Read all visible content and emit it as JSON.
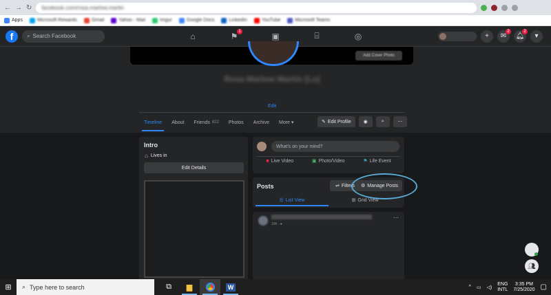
{
  "browser": {
    "url": "facebook.com/rosa.marlow.martin",
    "bookmarks": [
      "Apps",
      "Microsoft Rewards",
      "Gmail",
      "Yahoo - Mail",
      "Imgur",
      "Google Docs",
      "LinkedIn",
      "YouTube",
      "Microsoft Teams"
    ]
  },
  "header": {
    "search_placeholder": "Search Facebook",
    "nav_badge": "1",
    "messenger_badge": "2",
    "notifications_badge": "2"
  },
  "profile": {
    "add_cover_label": "Add Cover Photo",
    "name": "Rosa Marlow Martin (Lo)",
    "edit_link": "Edit",
    "tabs": [
      {
        "label": "Timeline"
      },
      {
        "label": "About"
      },
      {
        "label": "Friends",
        "count": "822"
      },
      {
        "label": "Photos"
      },
      {
        "label": "Archive"
      },
      {
        "label": "More"
      }
    ],
    "edit_profile_label": "Edit Profile"
  },
  "intro": {
    "title": "Intro",
    "lives_in": "Lives in",
    "edit_details_label": "Edit Details"
  },
  "composer": {
    "placeholder": "What's on your mind?",
    "actions": [
      "Live Video",
      "Photo/Video",
      "Life Event"
    ]
  },
  "posts": {
    "title": "Posts",
    "filters_label": "Filters",
    "manage_label": "Manage Posts",
    "list_view_label": "List View",
    "grid_view_label": "Grid View"
  },
  "post": {
    "time": "19h · ●"
  },
  "taskbar": {
    "search_placeholder": "Type here to search",
    "lang_line1": "ENG",
    "lang_line2": "INTL",
    "time": "3:35 PM",
    "date": "7/25/2020"
  }
}
